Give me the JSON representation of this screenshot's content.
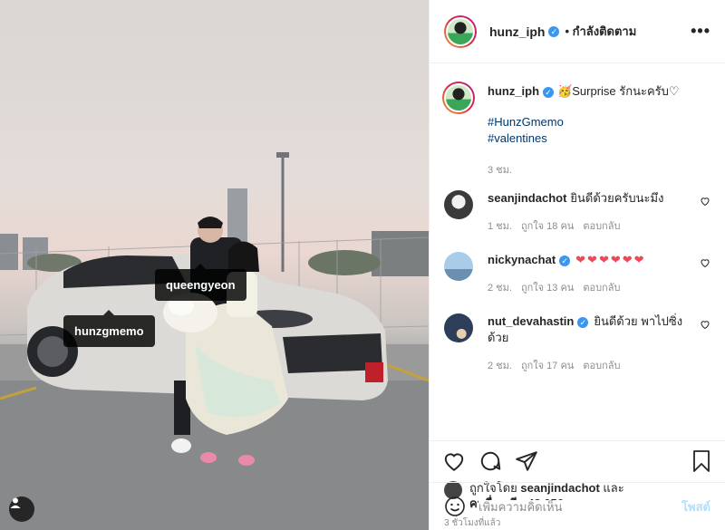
{
  "post": {
    "tags": [
      "queengyeon",
      "hunzgmemo"
    ]
  },
  "header": {
    "username": "hunz_iph",
    "follow_label": "• กำลังติดตาม",
    "more_icon": "ellipsis-icon"
  },
  "caption": {
    "username": "hunz_iph",
    "text": "🥳Surprise รักนะครับ♡",
    "hashtags": [
      "#HunzGmemo",
      "#valentines"
    ],
    "time": "3 ชม."
  },
  "comments": [
    {
      "username": "seanjindachot",
      "verified": false,
      "text": "ยินดีด้วยครับนะมึง",
      "time": "1 ชม.",
      "likes": "ถูกใจ 18 คน",
      "reply": "ตอบกลับ"
    },
    {
      "username": "nickynachat",
      "verified": true,
      "text": "❤❤❤❤❤❤",
      "time": "2 ชม.",
      "likes": "ถูกใจ 13 คน",
      "reply": "ตอบกลับ"
    },
    {
      "username": "nut_devahastin",
      "verified": true,
      "text": "ยินดีด้วย พาไปซิ่งด้วย",
      "time": "2 ชม.",
      "likes": "ถูกใจ 17 คน",
      "reply": "ตอบกลับ"
    }
  ],
  "likes": {
    "prefix": "ถูกใจโดย",
    "user": "seanjindachot",
    "joiner": "และ",
    "others": "คนอื่นๆ อีก 42,056 คน"
  },
  "time_ago": "3 ชั่วโมงที่แล้ว",
  "add_comment": {
    "placeholder": "เพิ่มความคิดเห็น",
    "post_label": "โพสต์"
  },
  "colors": {
    "verified": "#3897f0",
    "hashtag": "#00376b",
    "heart_red": "#ed4956",
    "post_disabled": "#b2dffc",
    "muted": "#8e8e8e"
  }
}
